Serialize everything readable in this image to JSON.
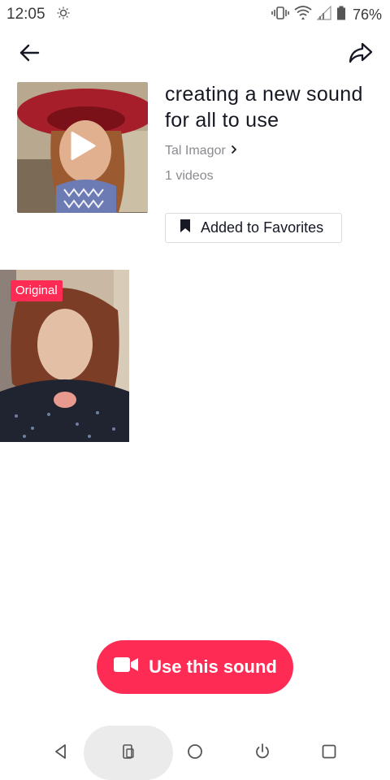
{
  "status_bar": {
    "time": "12:05",
    "battery": "76%"
  },
  "header": {
    "back_icon": "arrow-left-icon",
    "share_icon": "share-icon"
  },
  "sound": {
    "title": "creating a new sound for all to use",
    "author": "Tal Imagor",
    "video_count": "1 videos",
    "favorite_label": "Added to Favorites"
  },
  "videos": [
    {
      "badge": "Original"
    }
  ],
  "cta": {
    "use_sound_label": "Use this sound"
  },
  "colors": {
    "accent": "#fe2c55",
    "text": "#161823",
    "muted": "#8a8b91"
  }
}
